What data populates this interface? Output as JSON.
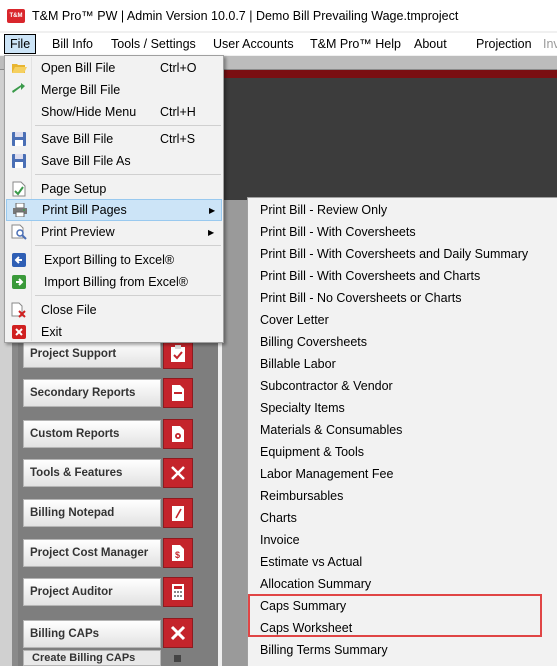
{
  "window": {
    "logo_text": "T&M",
    "title": "T&M Pro™ PW | Admin Version 10.0.7 | Demo Bill Prevailing Wage.tmproject"
  },
  "menubar": {
    "items": [
      {
        "label": "File"
      },
      {
        "label": "Bill Info"
      },
      {
        "label": "Tools / Settings"
      },
      {
        "label": "User Accounts"
      },
      {
        "label": "T&M Pro™ Help"
      },
      {
        "label": "About"
      },
      {
        "label": "Projection"
      },
      {
        "label": "Inv"
      }
    ]
  },
  "file_menu": {
    "items": [
      {
        "label": "Open Bill File",
        "shortcut": "Ctrl+O",
        "icon": "folder-open-icon"
      },
      {
        "label": "Merge Bill File",
        "shortcut": "",
        "icon": "merge-arrow-icon"
      },
      {
        "label": "Show/Hide Menu",
        "shortcut": "Ctrl+H",
        "icon": ""
      },
      {
        "label": "Save Bill File",
        "shortcut": "Ctrl+S",
        "icon": "floppy-disk-icon"
      },
      {
        "label": "Save Bill File As",
        "shortcut": "",
        "icon": "floppy-disk-icon"
      },
      {
        "label": "Page Setup",
        "shortcut": "",
        "icon": "page-setup-icon"
      },
      {
        "label": "Print Bill Pages",
        "shortcut": "",
        "icon": "printer-icon"
      },
      {
        "label": "Print Preview",
        "shortcut": "",
        "icon": "print-preview-icon"
      },
      {
        "label": "Export Billing to Excel®",
        "shortcut": "",
        "icon": "export-arrow-icon"
      },
      {
        "label": "Import Billing from Excel®",
        "shortcut": "",
        "icon": "import-arrow-icon"
      },
      {
        "label": "Close File",
        "shortcut": "",
        "icon": "close-file-icon"
      },
      {
        "label": "Exit",
        "shortcut": "",
        "icon": "exit-icon"
      }
    ]
  },
  "print_submenu": {
    "items": [
      "Print Bill - Review Only",
      "Print Bill - With Coversheets",
      "Print Bill - With Coversheets and Daily Summary",
      "Print Bill - With  Coversheets and Charts",
      "Print Bill - No Coversheets or Charts",
      "Cover Letter",
      "Billing Coversheets",
      "Billable Labor",
      "Subcontractor & Vendor",
      "Specialty Items",
      "Materials & Consumables",
      "Equipment & Tools",
      "Labor Management Fee",
      "Reimbursables",
      "Charts",
      "Invoice",
      "Estimate vs Actual",
      "Allocation Summary",
      "Caps Summary",
      "Caps Worksheet",
      "Billing Terms Summary"
    ]
  },
  "nav": {
    "buttons": [
      {
        "label": "Project Support",
        "icon": "clipboard-check-icon"
      },
      {
        "label": "Secondary Reports",
        "icon": "document-icon"
      },
      {
        "label": "Custom Reports",
        "icon": "gear-document-icon"
      },
      {
        "label": "Tools & Features",
        "icon": "wrench-screwdriver-icon"
      },
      {
        "label": "Billing Notepad",
        "icon": "notepad-icon"
      },
      {
        "label": "Project Cost Manager",
        "icon": "dollar-document-icon"
      },
      {
        "label": "Project Auditor",
        "icon": "calculator-icon"
      },
      {
        "label": "Billing CAPs",
        "icon": "x-icon"
      }
    ],
    "sub_button": "Create Billing CAPs"
  },
  "colors": {
    "accent_red": "#c4242b",
    "menu_highlight": "#cce4f7",
    "callout_border": "#e04545"
  }
}
